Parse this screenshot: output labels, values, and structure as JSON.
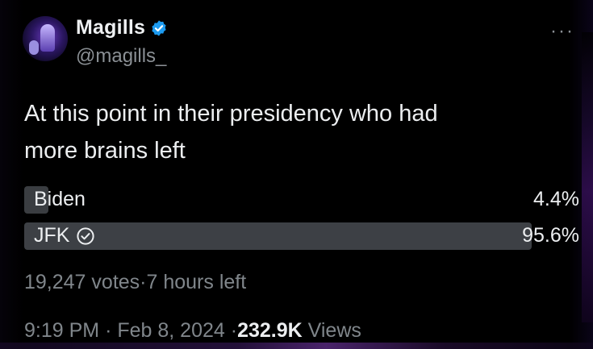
{
  "author": {
    "display_name": "Magills",
    "handle": "@magills_",
    "verified": true
  },
  "tweet": {
    "text_line1": "At this point in their presidency who had",
    "text_line2": "more brains left"
  },
  "poll": {
    "options": [
      {
        "label": "Biden",
        "percent_text": "4.4%",
        "percent": 4.4,
        "selected": false
      },
      {
        "label": "JFK",
        "percent_text": "95.6%",
        "percent": 95.6,
        "selected": true
      }
    ],
    "votes_text": "19,247 votes",
    "separator": "·",
    "time_left": "7 hours left"
  },
  "footer": {
    "time": "9:19 PM",
    "date": "Feb 8, 2024",
    "views_count": "232.9K",
    "views_label": "Views",
    "separator": "·"
  },
  "icons": {
    "verified": "verified-badge-icon",
    "selected": "check-circle-icon",
    "more": "more-dots-icon"
  },
  "colors": {
    "verified_blue": "#1d9bf0",
    "background": "#000000",
    "muted_text": "#80868b"
  }
}
